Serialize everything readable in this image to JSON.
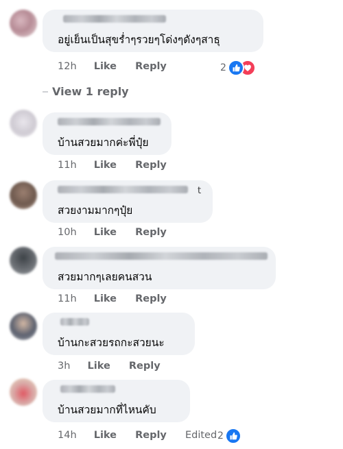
{
  "labels": {
    "like": "Like",
    "reply": "Reply",
    "edited": "Edited",
    "view_replies": "View 1 reply"
  },
  "comments": [
    {
      "text": "อยู่เย็นเป็นสุขร่ำๆรวยๆโด่งๆดังๆสาธุ",
      "time": "12h",
      "reaction_count": "2",
      "reactions": [
        "like-icon",
        "love-icon"
      ]
    },
    {
      "text": "บ้านสวยมากค่ะพี่ปุ๋ย",
      "time": "11h"
    },
    {
      "text": "สวยงามมากๆปุ๋ย",
      "time": "10h",
      "name_tail": "t"
    },
    {
      "text": "สวยมากๆเลยคนสวน",
      "time": "11h"
    },
    {
      "text": "บ้านกะสวยรถกะสวยนะ",
      "time": "3h"
    },
    {
      "text": "บ้านสวยมากที่ไหนคับ",
      "time": "14h",
      "edited": true,
      "reaction_count": "2",
      "reactions": [
        "like-icon"
      ]
    }
  ],
  "colors": {
    "bubble": "#f0f2f5",
    "meta_text": "#65676b",
    "like_blue": "#1877f2",
    "love_red": "#f33e58"
  }
}
